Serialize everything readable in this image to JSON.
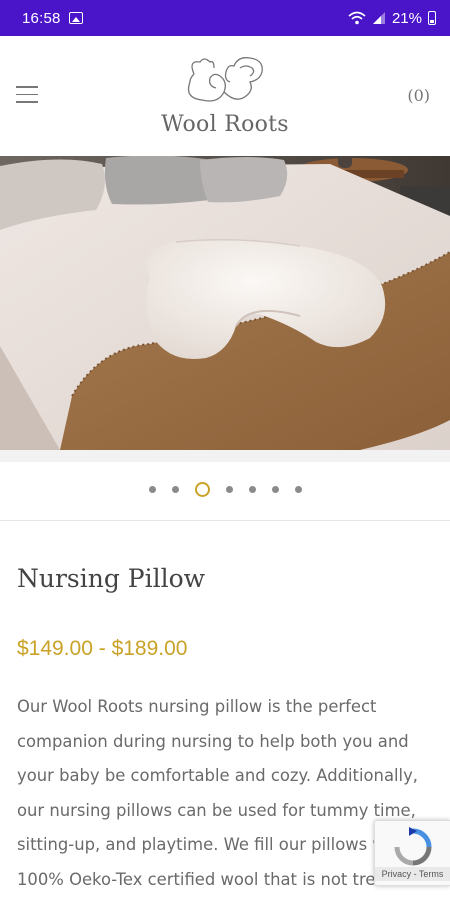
{
  "status_bar": {
    "time": "16:58",
    "battery": "21%",
    "icons": [
      "gallery-icon",
      "wifi-icon",
      "signal-icon",
      "battery-icon"
    ]
  },
  "header": {
    "logo_text": "Wool Roots",
    "cart_label": "(0)"
  },
  "carousel": {
    "dot_count": 7,
    "active_index": 2
  },
  "product": {
    "title": "Nursing Pillow",
    "price": "$149.00 - $189.00",
    "description": "Our Wool Roots nursing pillow is the perfect companion during nursing to help both you and your baby be comfortable and cozy. Additionally, our nursing pillows can be used for tummy time, sitting-up, and playtime. We fill our pillows with 100% Oeko-Tex certified wool that is not treated"
  },
  "recaptcha": {
    "links": "Privacy - Terms"
  },
  "colors": {
    "status_bar": "#4a14c8",
    "accent": "#c9a227",
    "text": "#6a6a6a"
  }
}
